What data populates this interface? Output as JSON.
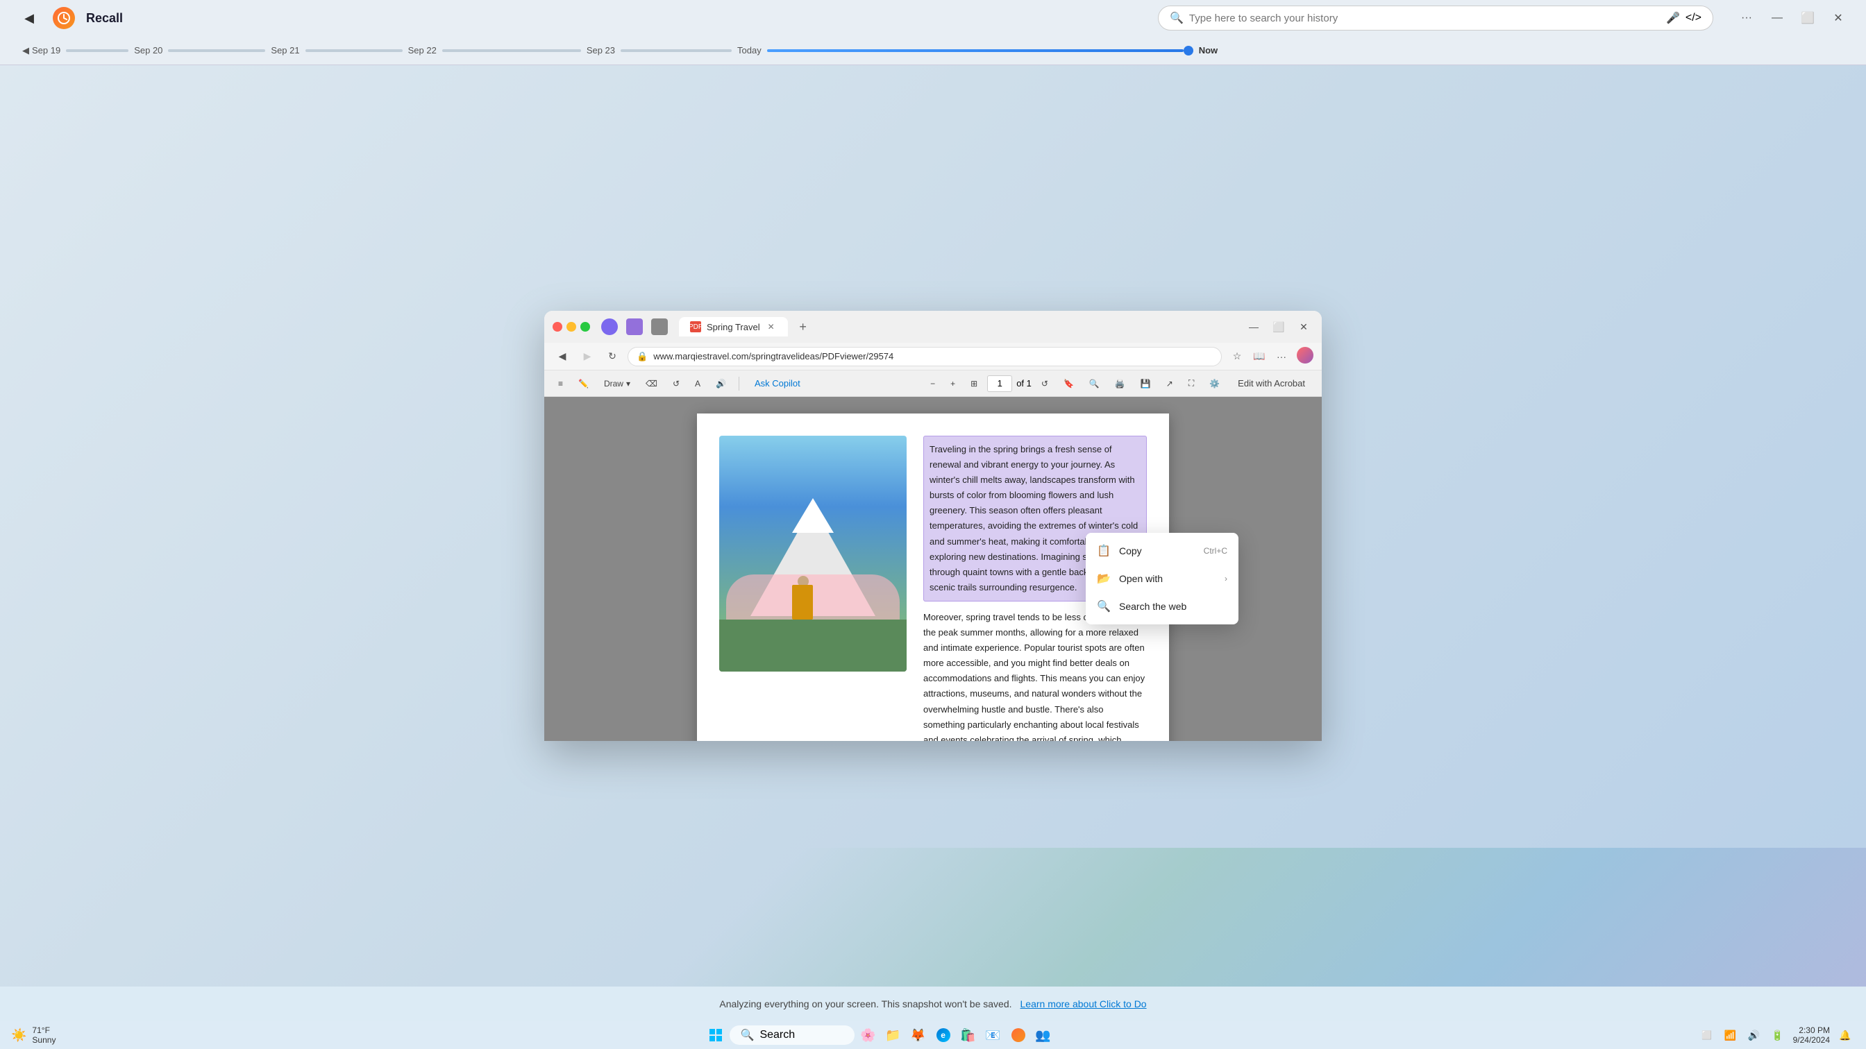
{
  "recall": {
    "title": "Recall",
    "search_placeholder": "Type here to search your history",
    "back_label": "◀",
    "now_label": "Now"
  },
  "timeline": {
    "items": [
      {
        "label": "Sep 19",
        "track_width": 80
      },
      {
        "label": "Sep 20",
        "track_width": 140
      },
      {
        "label": "Sep 21",
        "track_width": 140
      },
      {
        "label": "Sep 22",
        "track_width": 200
      },
      {
        "label": "Sep 23",
        "track_width": 160
      },
      {
        "label": "Today",
        "track_width": 300
      }
    ]
  },
  "browser": {
    "tab_title": "Spring Travel",
    "url": "www.marqiestravel.com/springtravelideas/PDFviewer/29574",
    "page_current": "1",
    "page_total": "of 1",
    "draw_label": "Draw",
    "ask_copilot_label": "Ask Copilot",
    "edit_acrobat_label": "Edit with Acrobat"
  },
  "pdf": {
    "highlighted_paragraph": "Traveling in the spring brings a fresh sense of renewal and vibrant energy to your journey. As winter's chill melts away, landscapes transform with bursts of color from blooming flowers and lush greenery. This season often offers pleasant temperatures, avoiding the extremes of winter's cold and summer's heat, making it comfortable for exploring new destinations. Imagining strolling through quaint towns with a gentle back or hiking scenic trails surrounding resurgence.",
    "normal_paragraph": "Moreover, spring travel tends to be less crowded than the peak summer months, allowing for a more relaxed and intimate experience. Popular tourist spots are often more accessible, and you might find better deals on accommodations and flights. This means you can enjoy attractions, museums, and natural wonders without the overwhelming hustle and bustle. There's also something particularly enchanting about local festivals and events celebrating the arrival of spring, which provide a deeper connection to the culture and traditions of the place you're visiting."
  },
  "context_menu": {
    "items": [
      {
        "label": "Copy",
        "shortcut": "Ctrl+C",
        "icon": "📋"
      },
      {
        "label": "Open with",
        "arrow": "›",
        "icon": "📂"
      },
      {
        "label": "Search the web",
        "icon": "🔍"
      }
    ]
  },
  "status_bar": {
    "message": "Analyzing everything on your screen. This snapshot won't be saved.",
    "link_text": "Learn more about Click to Do"
  },
  "taskbar": {
    "weather_temp": "71°F",
    "weather_desc": "Sunny",
    "search_label": "Search",
    "time": "2:30 PM",
    "date": "9/24/2024"
  }
}
